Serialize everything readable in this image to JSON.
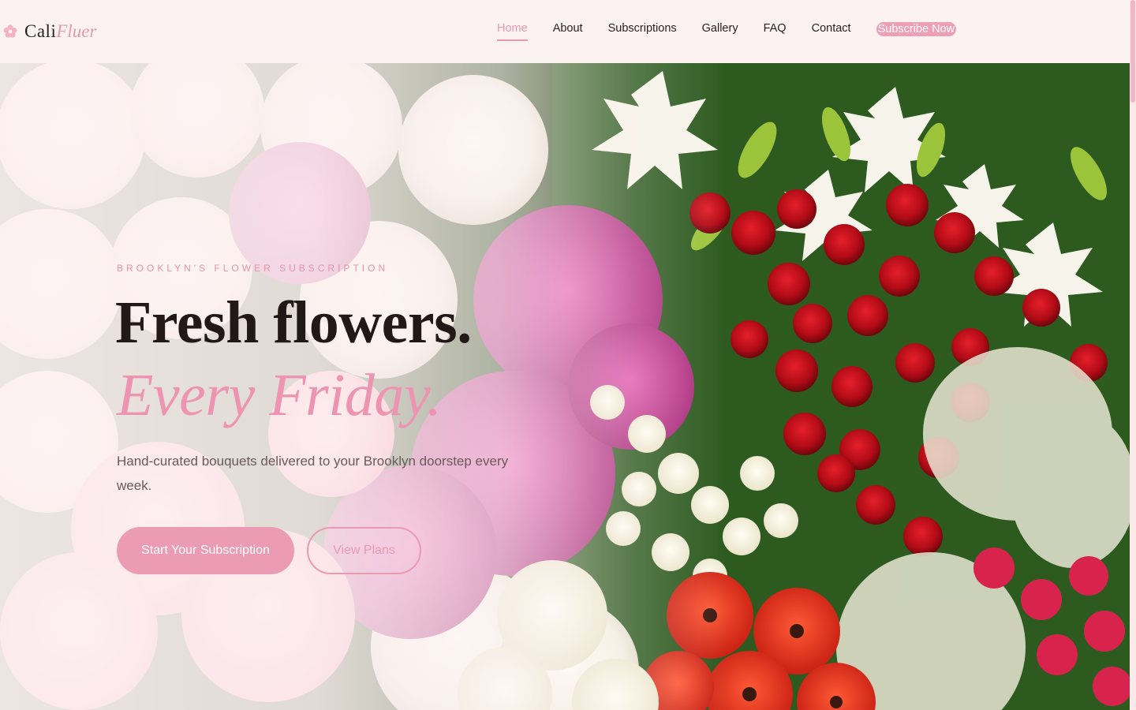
{
  "brand": {
    "name_part1": "Cali",
    "name_part2": "Fluer",
    "logo_icon": "flower-icon",
    "accent_color": "#ec9bb5"
  },
  "nav": {
    "items": [
      {
        "label": "Home",
        "active": true
      },
      {
        "label": "About",
        "active": false
      },
      {
        "label": "Subscriptions",
        "active": false
      },
      {
        "label": "Gallery",
        "active": false
      },
      {
        "label": "FAQ",
        "active": false
      },
      {
        "label": "Contact",
        "active": false
      }
    ],
    "cta_label": "Subscribe Now"
  },
  "hero": {
    "eyebrow": "Brooklyn's Flower Subscription",
    "headline_line1": "Fresh flowers.",
    "headline_line2": "Every Friday.",
    "subtext": "Hand-curated bouquets delivered to your Brooklyn doorstep every week.",
    "primary_button": "Start Your Subscription",
    "secondary_button": "View Plans",
    "image": "flower-market-photo"
  }
}
